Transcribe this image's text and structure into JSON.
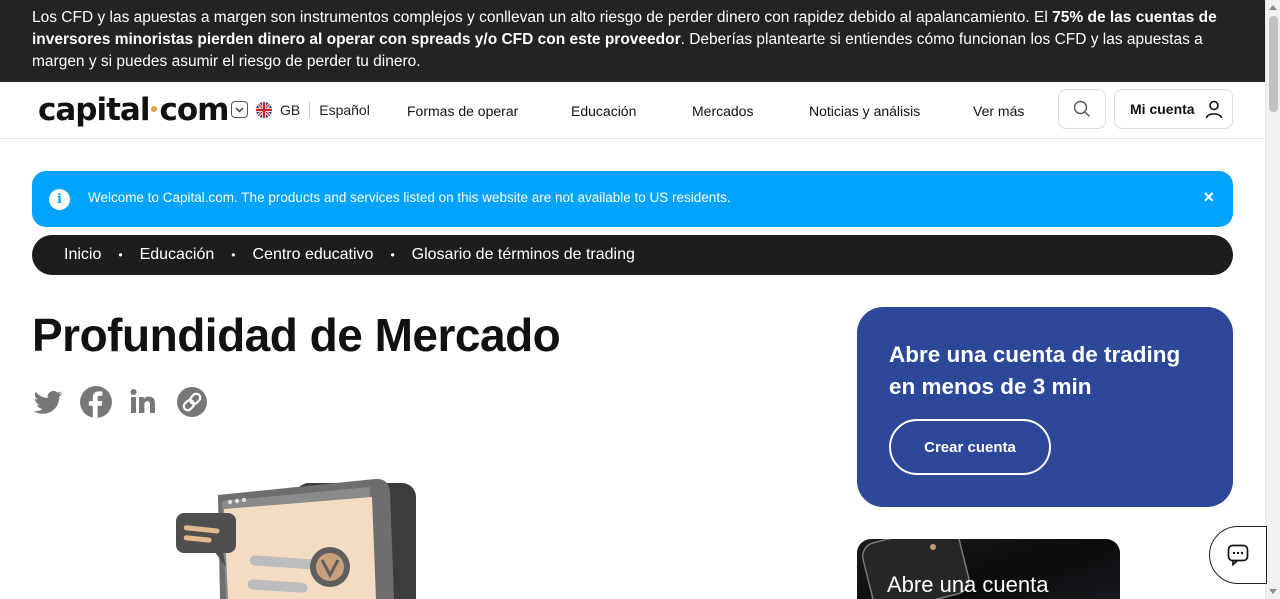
{
  "risk_banner": {
    "part1": "Los CFD y las apuestas a margen son instrumentos complejos y conllevan un alto riesgo de perder dinero con rapidez debido al apalancamiento. El ",
    "bold": "75% de las cuentas de inversores minoristas pierden dinero al operar con spreads y/o CFD con este proveedor",
    "part2": ". Deberías plantearte si entiendes cómo funcionan los CFD y las apuestas a margen y si puedes asumir el riesgo de perder tu dinero."
  },
  "header": {
    "logo_left": "capital",
    "logo_right": "com",
    "region": "GB",
    "language": "Español",
    "nav": [
      "Formas de operar",
      "Educación",
      "Mercados",
      "Noticias y análisis",
      "Ver más"
    ],
    "account_label": "Mi cuenta"
  },
  "info_bar": {
    "text": "Welcome to Capital.com. The products and services listed on this website are not available to US residents.",
    "close": "×"
  },
  "breadcrumb": [
    "Inicio",
    "Educación",
    "Centro educativo",
    "Glosario de términos de trading"
  ],
  "page": {
    "title": "Profundidad de Mercado"
  },
  "share_icons": [
    "twitter-icon",
    "facebook-icon",
    "linkedin-icon",
    "link-icon"
  ],
  "cta": {
    "title": "Abre una cuenta de trading en menos de 3 min",
    "button": "Crear cuenta"
  },
  "promo": {
    "title": "Abre una cuenta"
  },
  "colors": {
    "banner_bg": "#232323",
    "info_blue": "#00a3ff",
    "cta_blue": "#2d4899",
    "breadcrumb_bg": "#1d1d1d",
    "logo_dot": "#e0a24a",
    "share_grey": "#777777"
  }
}
